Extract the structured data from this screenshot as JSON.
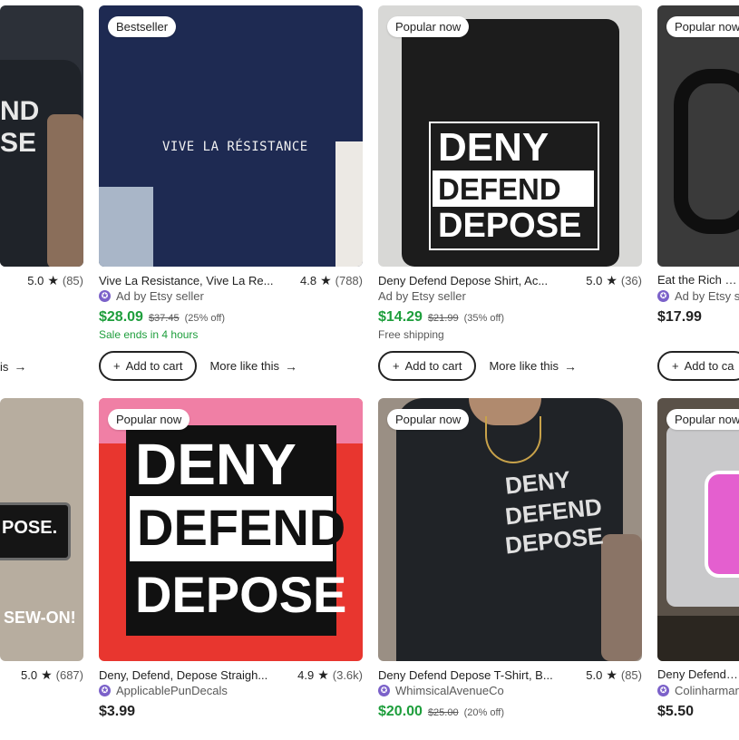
{
  "row1": [
    {
      "rating": "5.0",
      "count": "(85)",
      "more_label": "is",
      "arrow": "→",
      "design": [
        "ND",
        "SE"
      ]
    },
    {
      "badge": "Bestseller",
      "title": "Vive La Resistance, Vive La Re...",
      "rating": "4.8",
      "count": "(788)",
      "seller": "Ad by Etsy seller",
      "price": "$28.09",
      "original": "$37.45",
      "pct": "(25% off)",
      "note": "Sale ends in 4 hours",
      "cart_label": "Add to cart",
      "more_label": "More like this",
      "arrow": "→",
      "design": [
        "VIVE LA RÉSISTANCE"
      ]
    },
    {
      "badge": "Popular now",
      "title": "Deny Defend Depose Shirt, Ac...",
      "rating": "5.0",
      "count": "(36)",
      "seller": "Ad by Etsy seller",
      "price": "$14.29",
      "original": "$21.99",
      "pct": "(35% off)",
      "note": "Free shipping",
      "cart_label": "Add to cart",
      "more_label": "More like this",
      "arrow": "→",
      "design": [
        "DENY",
        "DEFEND",
        "DEPOSE"
      ]
    },
    {
      "badge": "Popular now",
      "title": "Eat the Rich Co",
      "seller": "Ad by Etsy s",
      "price": "$17.99",
      "cart_label": "Add to ca"
    }
  ],
  "row2": [
    {
      "rating": "5.0",
      "count": "(687)",
      "design": [
        "POSE.",
        "SEW-ON!"
      ]
    },
    {
      "badge": "Popular now",
      "title": "Deny, Defend, Depose Straigh...",
      "rating": "4.9",
      "count": "(3.6k)",
      "seller": "ApplicablePunDecals",
      "price": "$3.99",
      "design": [
        "DENY",
        "DEFEND",
        "DEPOSE"
      ]
    },
    {
      "badge": "Popular now",
      "title": "Deny Defend Depose T-Shirt, B...",
      "rating": "5.0",
      "count": "(85)",
      "seller": "WhimsicalAvenueCo",
      "price": "$20.00",
      "original": "$25.00",
      "pct": "(20% off)",
      "design": [
        "DENY",
        "DEFEND",
        "DEPOSE"
      ]
    },
    {
      "badge": "Popular now",
      "title": "Deny Defend De",
      "seller": "Colinharman",
      "price": "$5.50"
    }
  ],
  "icons": {
    "star": "★",
    "plus": "+",
    "star_seller": "✪"
  },
  "colors": {
    "sale_green": "#1e9e3c",
    "star_seller_purple": "#7b61c9"
  }
}
